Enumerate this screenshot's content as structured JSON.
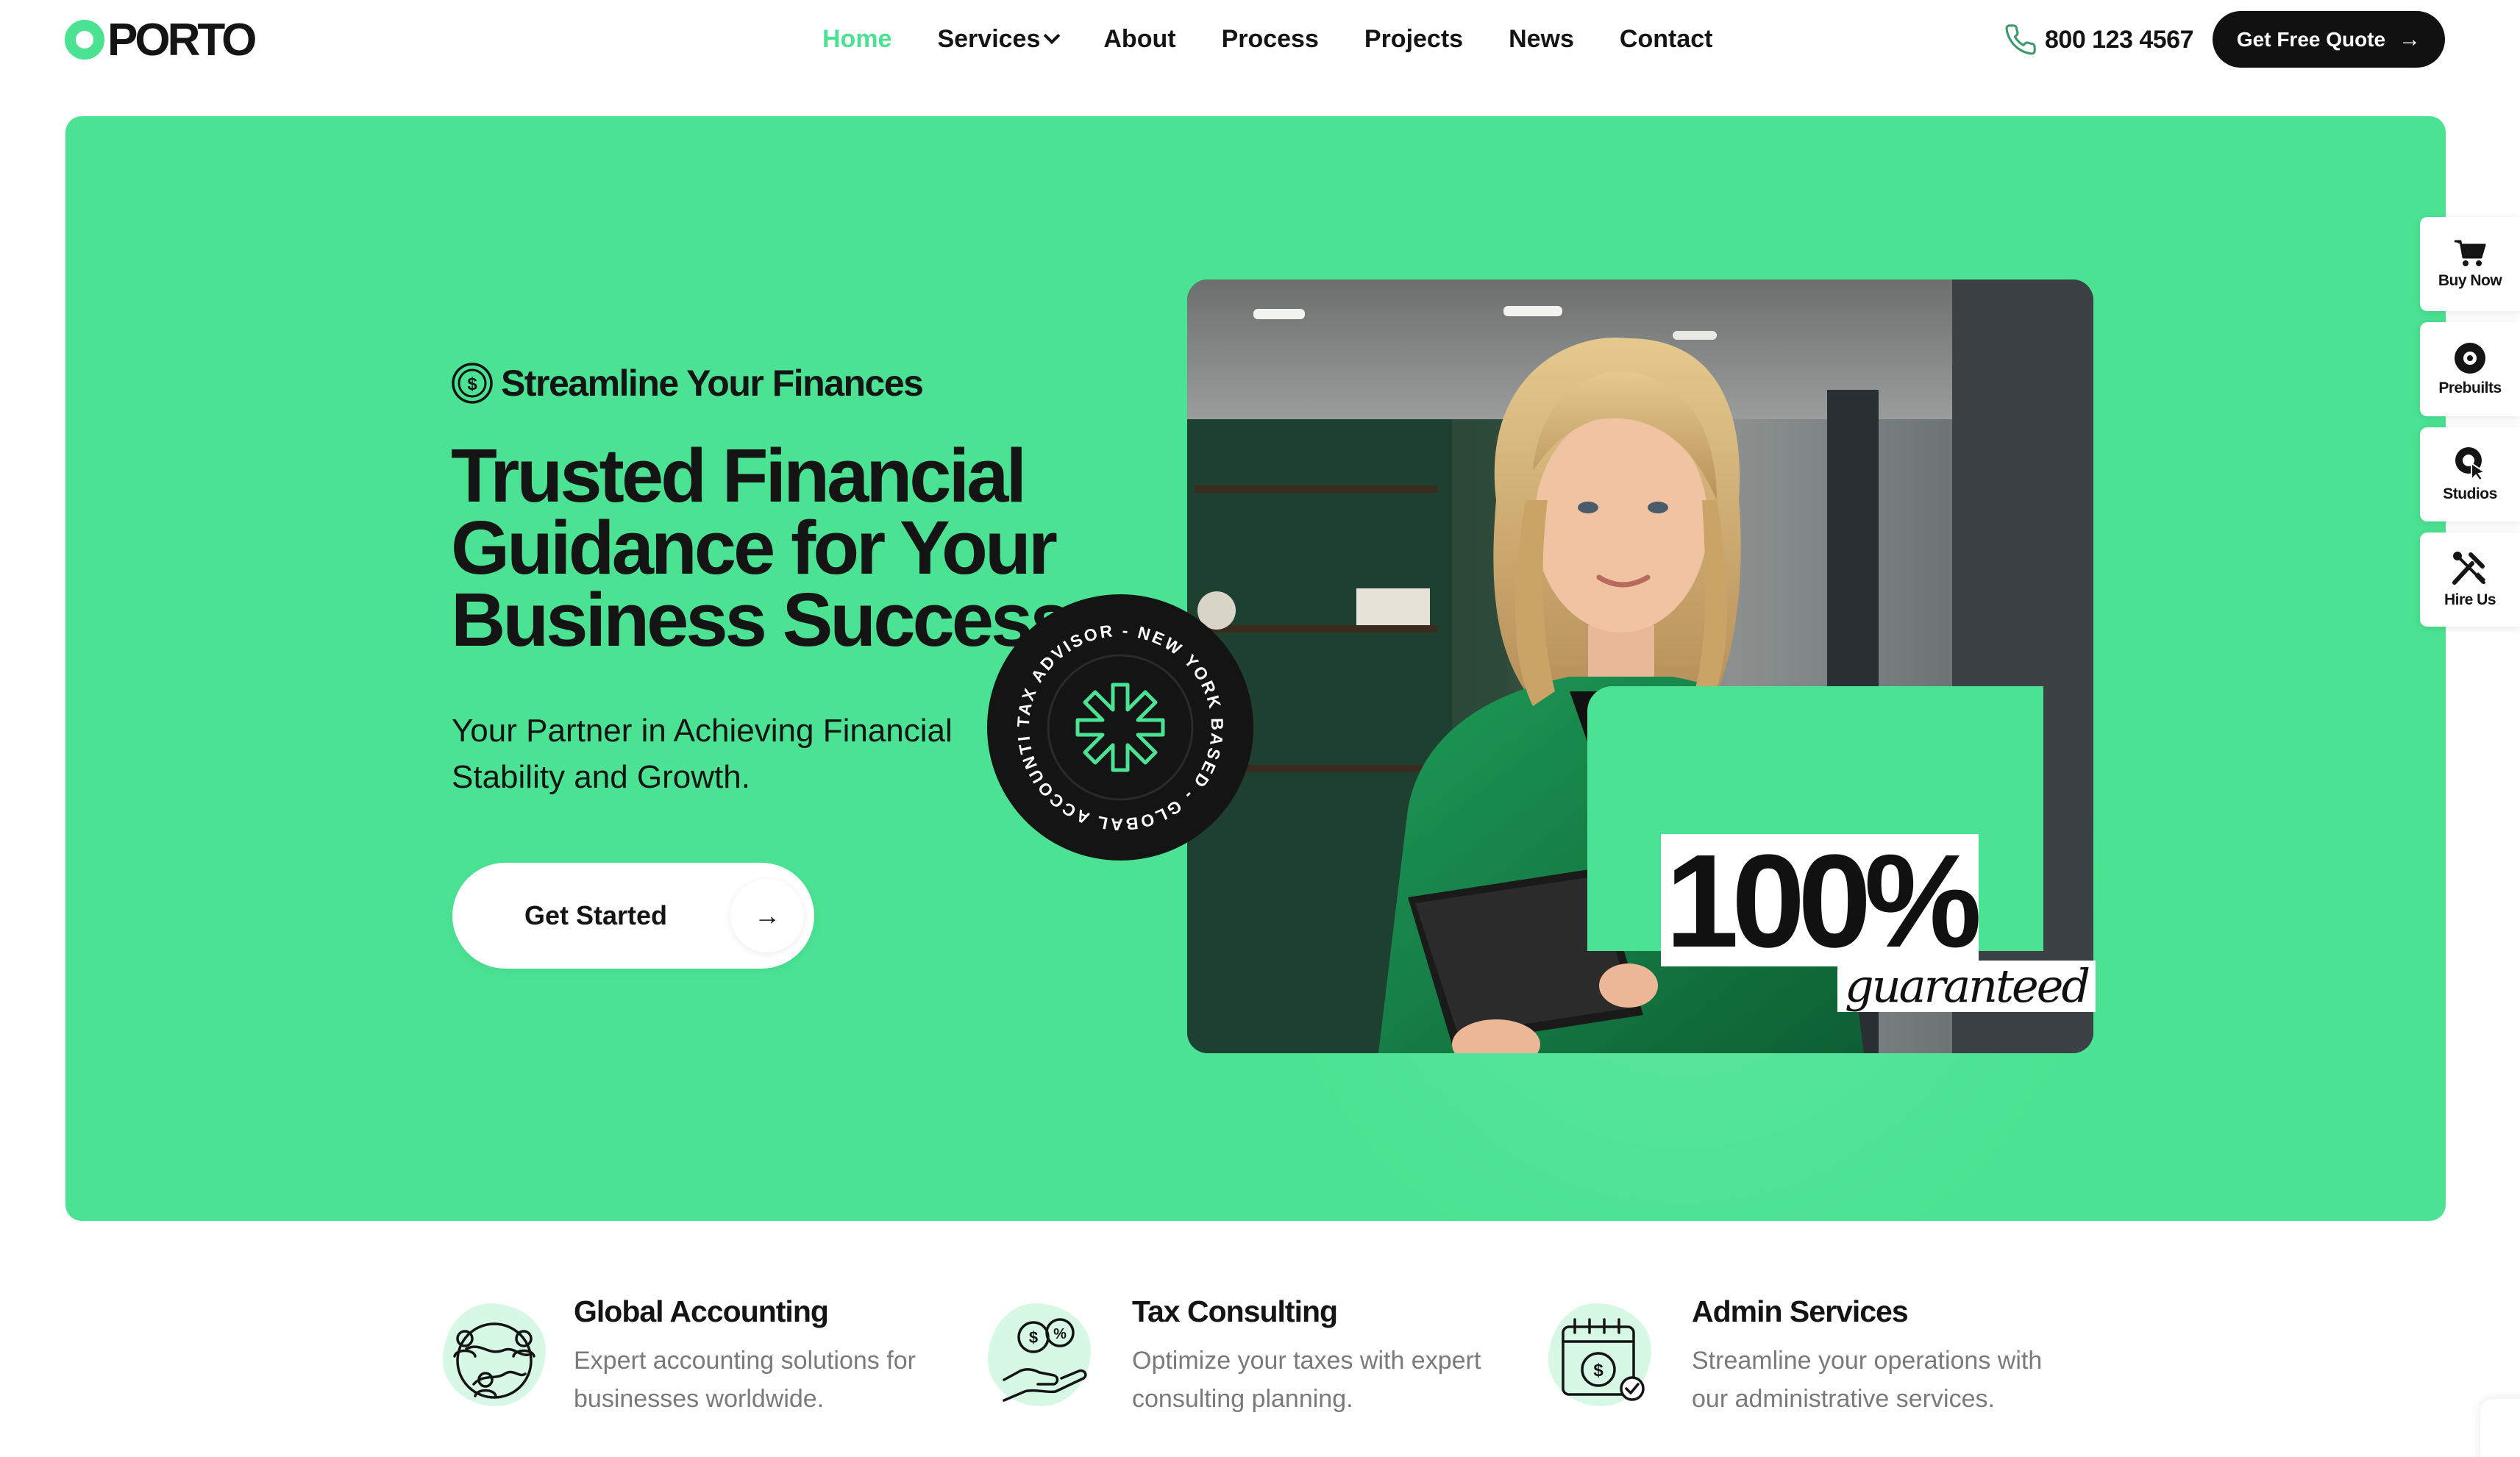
{
  "brand": {
    "name": "PORTO",
    "accent": "#4be393",
    "dark": "#111111"
  },
  "nav": {
    "items": [
      {
        "label": "Home",
        "active": true
      },
      {
        "label": "Services",
        "dropdown": true
      },
      {
        "label": "About"
      },
      {
        "label": "Process"
      },
      {
        "label": "Projects"
      },
      {
        "label": "News"
      },
      {
        "label": "Contact"
      }
    ]
  },
  "header": {
    "phone": "800 123 4567",
    "phone_icon": "phone-icon",
    "cta_label": "Get Free Quote",
    "cta_icon": "arrow-right-icon"
  },
  "hero": {
    "tagline": "Streamline Your Finances",
    "tagline_icon": "dollar-coin-icon",
    "headline_lines": [
      "Trusted Financial",
      "Guidance for Your",
      "Business Success."
    ],
    "subtext_lines": [
      "Your Partner in Achieving Financial",
      "Stability and Growth."
    ],
    "button_label": "Get Started",
    "button_icon": "arrow-right-icon",
    "stamp_text": "TAX ADVISOR - NEW YORK BASED - GLOBAL ACCOUNTING COMPANY - ",
    "stat_value": "100%",
    "stat_caption": "guaranteed",
    "background": "#4be393"
  },
  "sidebar": {
    "items": [
      {
        "label": "Buy Now",
        "icon": "cart-icon"
      },
      {
        "label": "Prebuilts",
        "icon": "disc-icon"
      },
      {
        "label": "Studios",
        "icon": "cursor-target-icon"
      },
      {
        "label": "Hire Us",
        "icon": "tools-icon"
      }
    ]
  },
  "features": [
    {
      "title": "Global Accounting",
      "desc_lines": [
        "Expert accounting solutions for",
        "businesses worldwide."
      ],
      "icon": "globe-people-icon"
    },
    {
      "title": "Tax Consulting",
      "desc_lines": [
        "Optimize your taxes with expert",
        "consulting planning."
      ],
      "icon": "hand-coins-icon"
    },
    {
      "title": "Admin Services",
      "desc_lines": [
        "Streamline your operations with",
        "our administrative services."
      ],
      "icon": "calendar-dollar-icon"
    }
  ]
}
